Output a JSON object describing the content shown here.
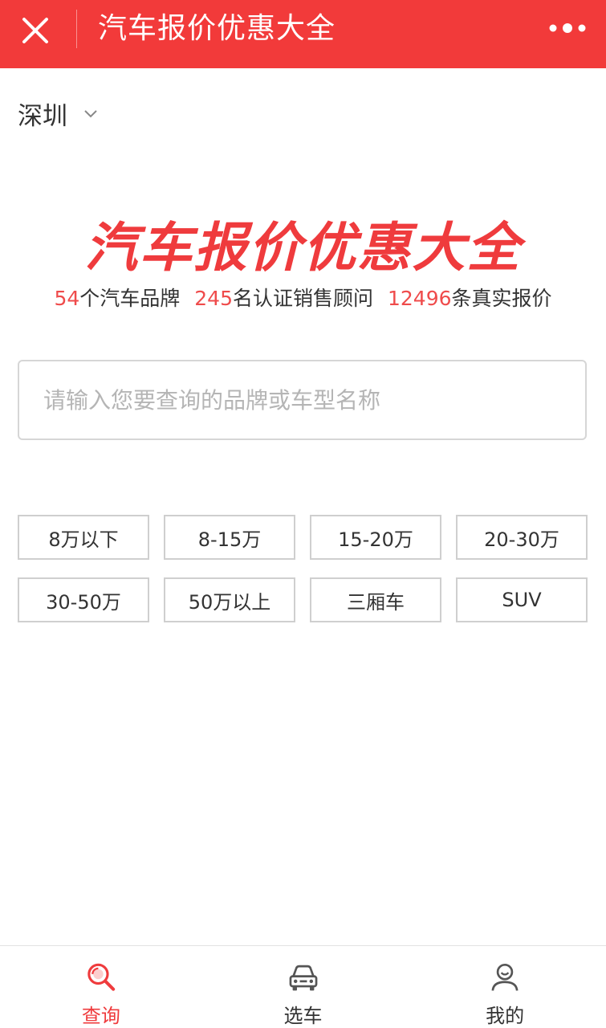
{
  "header": {
    "title": "汽车报价优惠大全",
    "bg_color": "#f23a3a",
    "close_icon": "close-icon",
    "more_icon": "more-dots-icon"
  },
  "location": {
    "city": "深圳",
    "icon": "chevron-down-icon"
  },
  "brand": {
    "title": "汽车报价优惠大全",
    "color": "#ef3b3d"
  },
  "stats": [
    {
      "value": "54",
      "label": "个汽车品牌"
    },
    {
      "value": "245",
      "label": "名认证销售顾问"
    },
    {
      "value": "12496",
      "label": "条真实报价"
    }
  ],
  "search": {
    "placeholder": "请输入您要查询的品牌或车型名称",
    "value": ""
  },
  "filters": [
    {
      "label": "8万以下"
    },
    {
      "label": "8-15万"
    },
    {
      "label": "15-20万"
    },
    {
      "label": "20-30万"
    },
    {
      "label": "30-50万"
    },
    {
      "label": "50万以上"
    },
    {
      "label": "三厢车"
    },
    {
      "label": "SUV"
    }
  ],
  "tabbar": {
    "active_color": "#ef3b3d",
    "items": [
      {
        "label": "查询",
        "icon": "search-icon",
        "active": true
      },
      {
        "label": "选车",
        "icon": "car-icon",
        "active": false
      },
      {
        "label": "我的",
        "icon": "user-icon",
        "active": false
      }
    ]
  }
}
